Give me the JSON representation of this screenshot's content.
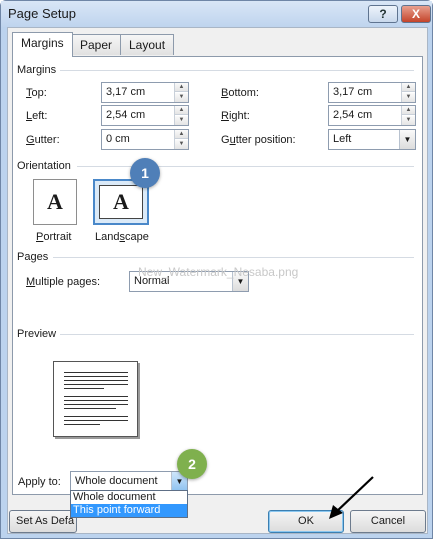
{
  "window": {
    "title": "Page Setup",
    "help_label": "?",
    "close_label": "X"
  },
  "tabs": [
    {
      "label": "Margins",
      "active": true
    },
    {
      "label": "Paper",
      "active": false
    },
    {
      "label": "Layout",
      "active": false
    }
  ],
  "margins": {
    "group_label": "Margins",
    "top_label": "Top:",
    "top_value": "3,17 cm",
    "bottom_label": "Bottom:",
    "bottom_value": "3,17 cm",
    "left_label": "Left:",
    "left_value": "2,54 cm",
    "right_label": "Right:",
    "right_value": "2,54 cm",
    "gutter_label": "Gutter:",
    "gutter_value": "0 cm",
    "gutter_position_label": "Gutter position:",
    "gutter_position_value": "Left"
  },
  "orientation": {
    "group_label": "Orientation",
    "portrait_label": "Portrait",
    "landscape_label": "Landscape",
    "glyph": "A",
    "selected": "landscape"
  },
  "pages": {
    "group_label": "Pages",
    "multiple_pages_label": "Multiple pages:",
    "multiple_pages_value": "Normal"
  },
  "preview": {
    "group_label": "Preview"
  },
  "watermark": "New_Watermark_Nesaba.png",
  "apply_to": {
    "label": "Apply to:",
    "value": "Whole document",
    "options": [
      "Whole document",
      "This point forward"
    ],
    "highlighted": "This point forward"
  },
  "badges": [
    {
      "number": "1"
    },
    {
      "number": "2"
    }
  ],
  "buttons": {
    "set_default_label": "Set As Defa",
    "ok_label": "OK",
    "cancel_label": "Cancel"
  },
  "colors": {
    "badge_1": "#4f7fb8",
    "badge_2": "#7fb04e",
    "selection": "#3298fe"
  }
}
